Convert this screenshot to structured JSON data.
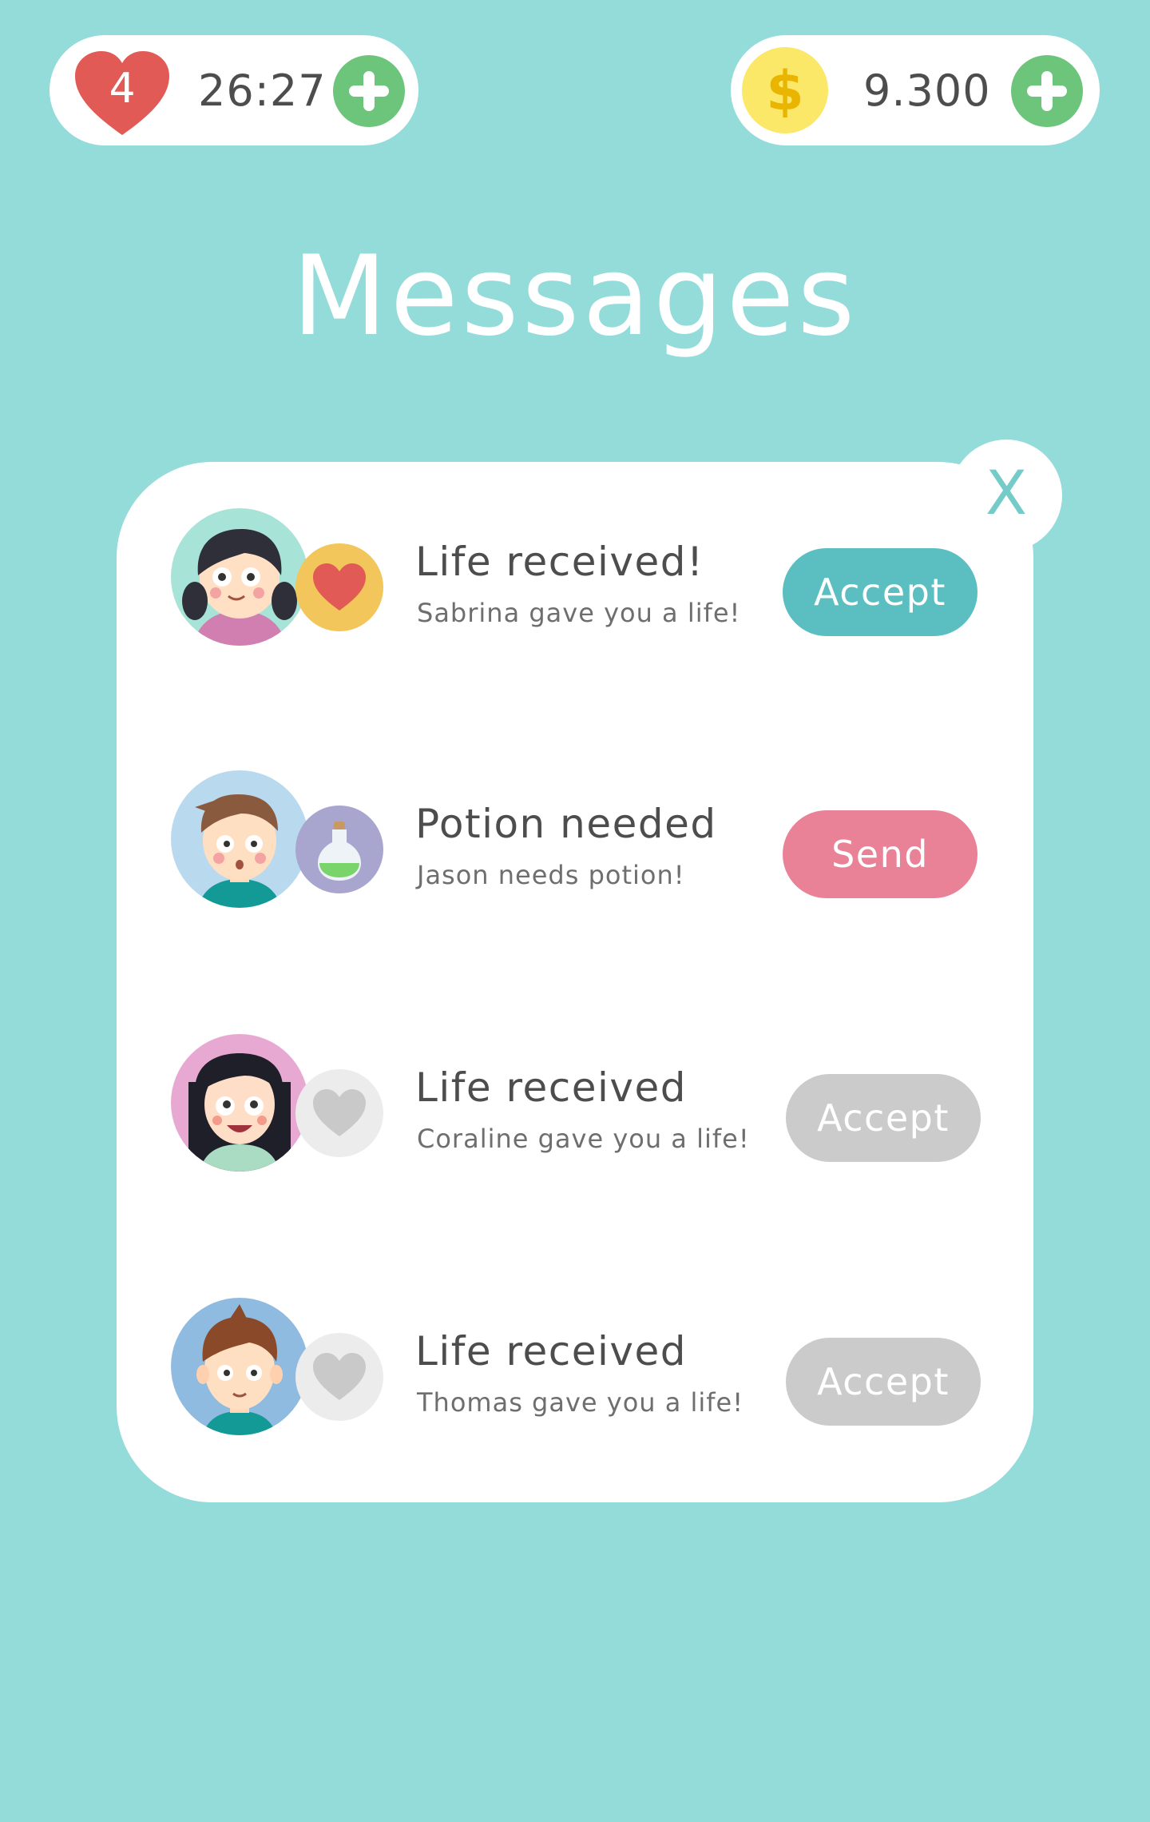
{
  "header": {
    "lives": {
      "count": "4",
      "timer": "26:27"
    },
    "coins": {
      "symbol": "$",
      "amount": "9.300"
    }
  },
  "page": {
    "title": "Messages",
    "close_label": "X"
  },
  "messages": [
    {
      "title": "Life received!",
      "subtitle": "Sabrina gave you a life!",
      "action": "Accept",
      "badge": "heart-icon",
      "state": "active"
    },
    {
      "title": "Potion needed",
      "subtitle": "Jason needs potion!",
      "action": "Send",
      "badge": "potion-icon",
      "state": "active"
    },
    {
      "title": "Life received",
      "subtitle": "Coraline gave you a life!",
      "action": "Accept",
      "badge": "heart-icon",
      "state": "disabled"
    },
    {
      "title": "Life received",
      "subtitle": "Thomas gave you a life!",
      "action": "Accept",
      "badge": "heart-icon",
      "state": "disabled"
    }
  ],
  "colors": {
    "background": "#93dcda",
    "accept": "#5bbfc2",
    "send": "#e98296",
    "disabled": "#cbcbcb",
    "plus": "#6cc57a",
    "heart": "#e25a55",
    "coin": "#fbe768"
  }
}
